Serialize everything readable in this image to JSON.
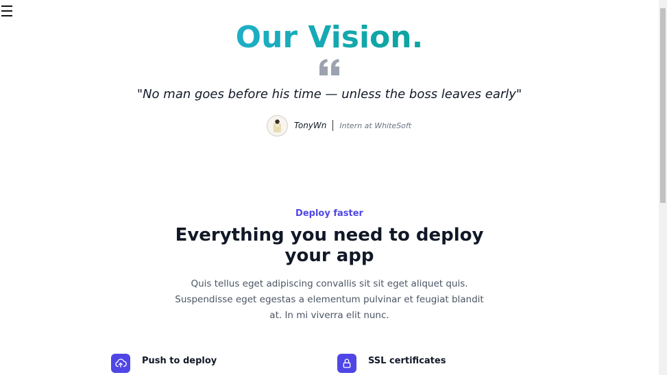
{
  "vision": {
    "title": "Our Vision.",
    "quote": "\"No man goes before his time — unless the boss leaves early\"",
    "author_name": "TonyWn",
    "author_role": "Intern at WhiteSoft"
  },
  "section": {
    "eyebrow": "Deploy faster",
    "headline": "Everything you need to deploy your app",
    "lead": "Quis tellus eget adipiscing convallis sit sit eget aliquet quis. Suspendisse eget egestas a elementum pulvinar et feugiat blandit at. In mi viverra elit nunc."
  },
  "features": [
    {
      "label": "Push to deploy",
      "icon": "cloud-upload-icon"
    },
    {
      "label": "SSL certificates",
      "icon": "lock-icon"
    }
  ],
  "colors": {
    "accent": "#4f46e5",
    "title_gradient_start": "#38bdf8",
    "title_gradient_end": "#10a37f"
  }
}
